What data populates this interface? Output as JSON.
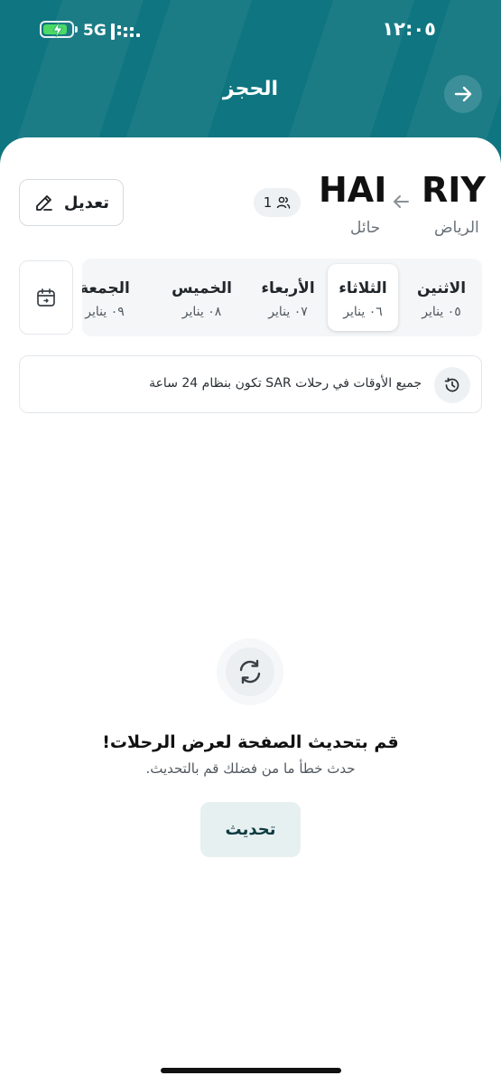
{
  "status_bar": {
    "time": "١٢:٠٥",
    "network": "5G",
    "battery_level": 0.85
  },
  "header": {
    "title": "الحجز",
    "back_icon": "arrow-right-icon"
  },
  "route": {
    "origin_code": "RIY",
    "origin_city": "الرياض",
    "destination_code": "HAI",
    "destination_city": "حائل",
    "passengers": "1",
    "edit_label": "تعديل"
  },
  "dates": [
    {
      "day": "الاثنين",
      "date": "٠٥ يناير",
      "active": false
    },
    {
      "day": "الثلاثاء",
      "date": "٠٦ يناير",
      "active": true
    },
    {
      "day": "الأربعاء",
      "date": "٠٧ يناير",
      "active": false
    },
    {
      "day": "الخميس",
      "date": "٠٨ يناير",
      "active": false
    },
    {
      "day": "الجمعة",
      "date": "٠٩ يناير",
      "active": false
    }
  ],
  "note": {
    "text": "جميع الأوقات في رحلات SAR تكون بنظام 24 ساعة"
  },
  "error": {
    "title": "قم بتحديث الصفحة لعرض الرحلات!",
    "subtitle": "حدث خطأ ما من فضلك قم بالتحديث.",
    "button_label": "تحديث"
  },
  "colors": {
    "header": "#0f7580",
    "accent_light": "#e6f0f1"
  }
}
